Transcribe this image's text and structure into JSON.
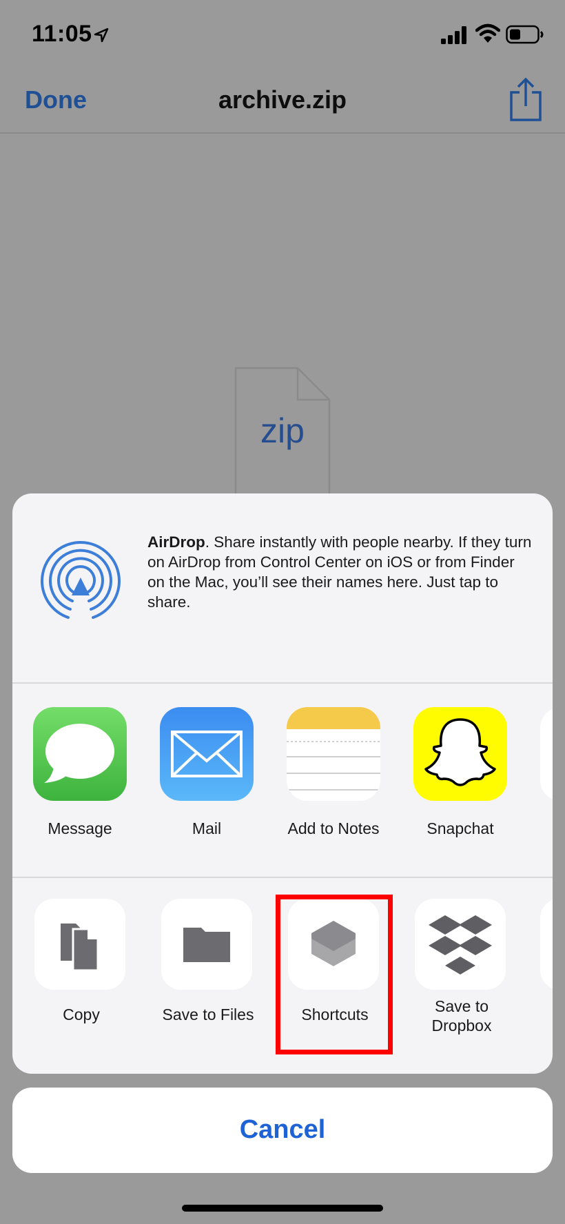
{
  "status_bar": {
    "time": "11:05"
  },
  "nav": {
    "done_label": "Done",
    "title": "archive.zip"
  },
  "file_preview": {
    "label": "zip"
  },
  "airdrop": {
    "title": "AirDrop",
    "text": ". Share instantly with people nearby. If they turn on AirDrop from Control Center on iOS or from Finder on the Mac, you’ll see their names here. Just tap to share."
  },
  "apps": [
    {
      "label": "Message",
      "icon": "message-icon"
    },
    {
      "label": "Mail",
      "icon": "mail-icon"
    },
    {
      "label": "Add to Notes",
      "icon": "notes-icon"
    },
    {
      "label": "Snapchat",
      "icon": "snapchat-icon"
    }
  ],
  "actions": [
    {
      "label": "Copy",
      "icon": "copy-icon"
    },
    {
      "label": "Save to Files",
      "icon": "folder-icon"
    },
    {
      "label": "Shortcuts",
      "icon": "shortcuts-icon"
    },
    {
      "label": "Save to Dropbox",
      "label_line1": "Save to",
      "label_line2": "Dropbox",
      "icon": "dropbox-icon"
    }
  ],
  "cancel_label": "Cancel",
  "colors": {
    "accent": "#1e63d6",
    "highlight": "#ff0000",
    "dim_background": "#9a9a9a"
  }
}
